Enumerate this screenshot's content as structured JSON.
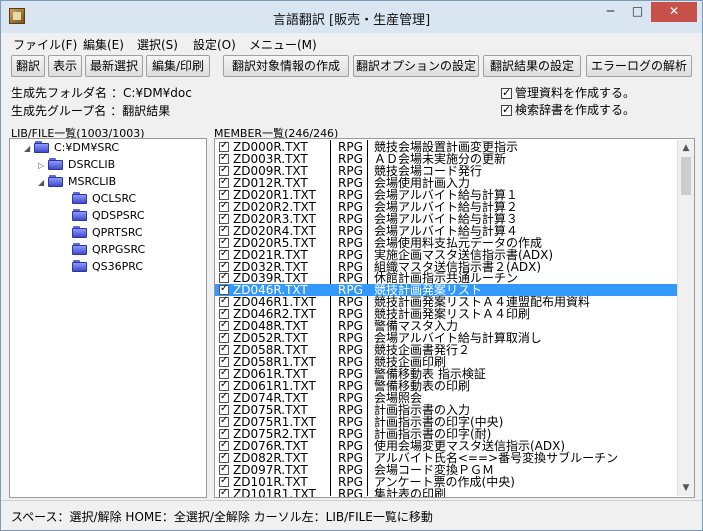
{
  "window": {
    "title": "言語翻訳 [販売・生産管理]",
    "minimize": "─",
    "maximize": "□",
    "close": "✕"
  },
  "menu": [
    "ファイル(F)",
    "編集(E)",
    "選択(S)",
    "設定(O)",
    "メニュー(M)"
  ],
  "toolbar": [
    "翻訳",
    "表示",
    "最新選択",
    "編集/印刷",
    "翻訳対象情報の作成",
    "翻訳オプションの設定",
    "翻訳結果の設定",
    "エラーログの解析"
  ],
  "info": {
    "folder_label": "生成先フォルダ名",
    "folder_value": "：C:¥DM¥doc",
    "group_label": "生成先グループ名",
    "group_value": "：翻訳結果",
    "check1": "管理資料を作成する。",
    "check2": "検索辞書を作成する。"
  },
  "libfile": {
    "header": "LIB/FILE一覧(1003/1003)",
    "nodes": [
      {
        "label": "C:¥DM¥SRC",
        "expander": "◢"
      },
      {
        "label": "DSRCLIB",
        "expander": "▷"
      },
      {
        "label": "MSRCLIB",
        "expander": "◢"
      },
      {
        "label": "QCLSRC",
        "expander": ""
      },
      {
        "label": "QDSPSRC",
        "expander": ""
      },
      {
        "label": "QPRTSRC",
        "expander": ""
      },
      {
        "label": "QRPGSRC",
        "expander": ""
      },
      {
        "label": "QS36PRC",
        "expander": ""
      }
    ]
  },
  "member": {
    "header": "MEMBER一覧(246/246)",
    "rows": [
      {
        "name": "ZD000R.TXT",
        "type": "RPG",
        "desc": "競技会場設置計画変更指示"
      },
      {
        "name": "ZD003R.TXT",
        "type": "RPG",
        "desc": "ＡＤ会場未実施分の更新"
      },
      {
        "name": "ZD009R.TXT",
        "type": "RPG",
        "desc": "競技会場コード発行"
      },
      {
        "name": "ZD012R.TXT",
        "type": "RPG",
        "desc": "会場使用計画入力"
      },
      {
        "name": "ZD020R1.TXT",
        "type": "RPG",
        "desc": "会場アルバイト給与計算１"
      },
      {
        "name": "ZD020R2.TXT",
        "type": "RPG",
        "desc": "会場アルバイト給与計算２"
      },
      {
        "name": "ZD020R3.TXT",
        "type": "RPG",
        "desc": "会場アルバイト給与計算３"
      },
      {
        "name": "ZD020R4.TXT",
        "type": "RPG",
        "desc": "会場アルバイト給与計算４"
      },
      {
        "name": "ZD020R5.TXT",
        "type": "RPG",
        "desc": "会場使用料支払元データの作成"
      },
      {
        "name": "ZD021R.TXT",
        "type": "RPG",
        "desc": "実施企画マスタ送信指示書(ADX)"
      },
      {
        "name": "ZD032R.TXT",
        "type": "RPG",
        "desc": "組織マスタ送信指示書２(ADX)"
      },
      {
        "name": "ZD039R.TXT",
        "type": "RPG",
        "desc": "休館計画指示共通ルーチン"
      },
      {
        "name": "ZD046R.TXT",
        "type": "RPG",
        "desc": "競技計画発案リスト"
      },
      {
        "name": "ZD046R1.TXT",
        "type": "RPG",
        "desc": "競技計画発案リストＡ４連盟配布用資料"
      },
      {
        "name": "ZD046R2.TXT",
        "type": "RPG",
        "desc": "競技計画発案リストＡ４印刷"
      },
      {
        "name": "ZD048R.TXT",
        "type": "RPG",
        "desc": "警備マスタ入力"
      },
      {
        "name": "ZD052R.TXT",
        "type": "RPG",
        "desc": "会場アルバイト給与計算取消し"
      },
      {
        "name": "ZD058R.TXT",
        "type": "RPG",
        "desc": "競技企画書発行２"
      },
      {
        "name": "ZD058R1.TXT",
        "type": "RPG",
        "desc": "競技企画印刷"
      },
      {
        "name": "ZD061R.TXT",
        "type": "RPG",
        "desc": "警備移動表 指示検証"
      },
      {
        "name": "ZD061R1.TXT",
        "type": "RPG",
        "desc": "警備移動表の印刷"
      },
      {
        "name": "ZD074R.TXT",
        "type": "RPG",
        "desc": "会場照会"
      },
      {
        "name": "ZD075R.TXT",
        "type": "RPG",
        "desc": "計画指示書の入力"
      },
      {
        "name": "ZD075R1.TXT",
        "type": "RPG",
        "desc": "計画指示書の印字(中央)"
      },
      {
        "name": "ZD075R2.TXT",
        "type": "RPG",
        "desc": "計画指示書の印字(耐)"
      },
      {
        "name": "ZD076R.TXT",
        "type": "RPG",
        "desc": "使用会場変更マスタ送信指示(ADX)"
      },
      {
        "name": "ZD082R.TXT",
        "type": "RPG",
        "desc": "アルバイト氏名<==>番号変換サブルーチン"
      },
      {
        "name": "ZD097R.TXT",
        "type": "RPG",
        "desc": "会場コード変換ＰＧＭ"
      },
      {
        "name": "ZD101R.TXT",
        "type": "RPG",
        "desc": "アンケート票の作成(中央)"
      },
      {
        "name": "ZD101R1.TXT",
        "type": "RPG",
        "desc": "集計表の印刷"
      }
    ]
  },
  "status": "スペース：選択/解除  HOME：全選択/全解除  カーソル左：LIB/FILE一覧に移動"
}
